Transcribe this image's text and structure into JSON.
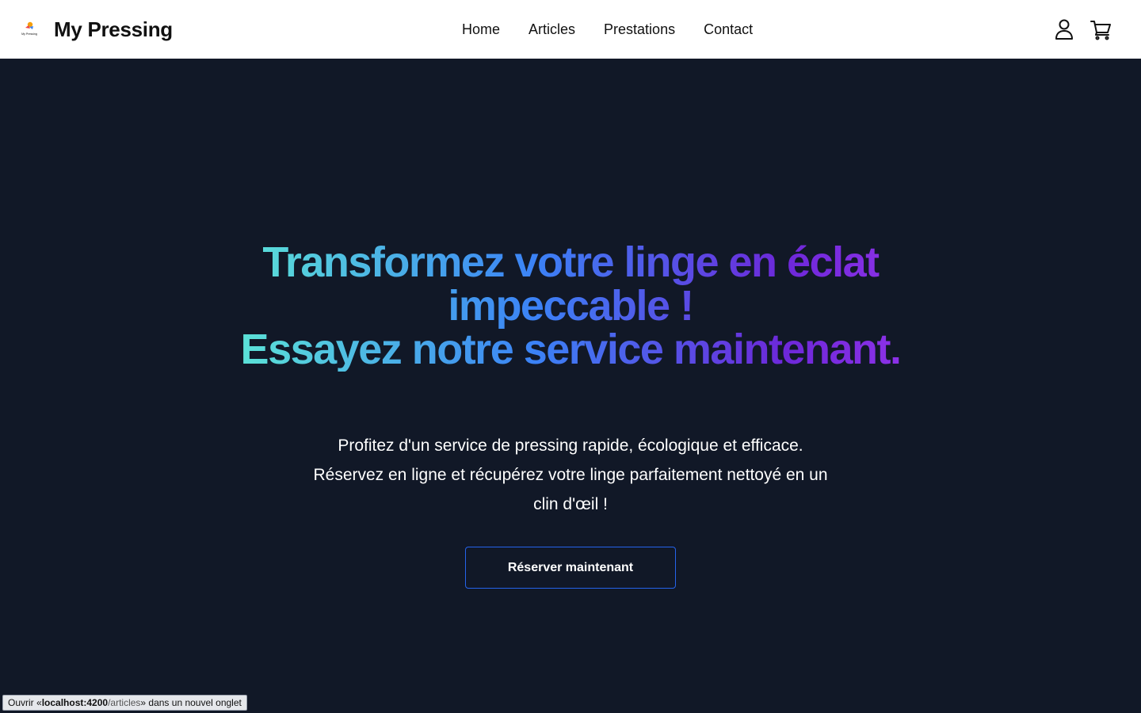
{
  "header": {
    "brand_name": "My Pressing",
    "logo_text": "My Pressing",
    "nav": [
      {
        "label": "Home"
      },
      {
        "label": "Articles"
      },
      {
        "label": "Prestations"
      },
      {
        "label": "Contact"
      }
    ],
    "icons": [
      "user-icon",
      "cart-icon"
    ]
  },
  "hero": {
    "title_line1": "Transformez votre linge en éclat impeccable !",
    "title_line2": "Essayez notre service maintenant.",
    "subtitle": "Profitez d'un service de pressing rapide, écologique et efficace. Réservez en ligne et récupérez votre linge parfaitement nettoyé en un clin d'œil !",
    "cta_label": "Réserver maintenant",
    "gradient_colors": [
      "#5eead4",
      "#3b82f6",
      "#6d28d9",
      "#9333ea"
    ]
  },
  "status_bar": {
    "prefix": "Ouvrir « ",
    "host": "localhost:4200",
    "path": "/articles",
    "suffix": " » dans un nouvel onglet"
  },
  "colors": {
    "header_bg": "#ffffff",
    "hero_bg": "#111827",
    "cta_border": "#2563eb"
  }
}
